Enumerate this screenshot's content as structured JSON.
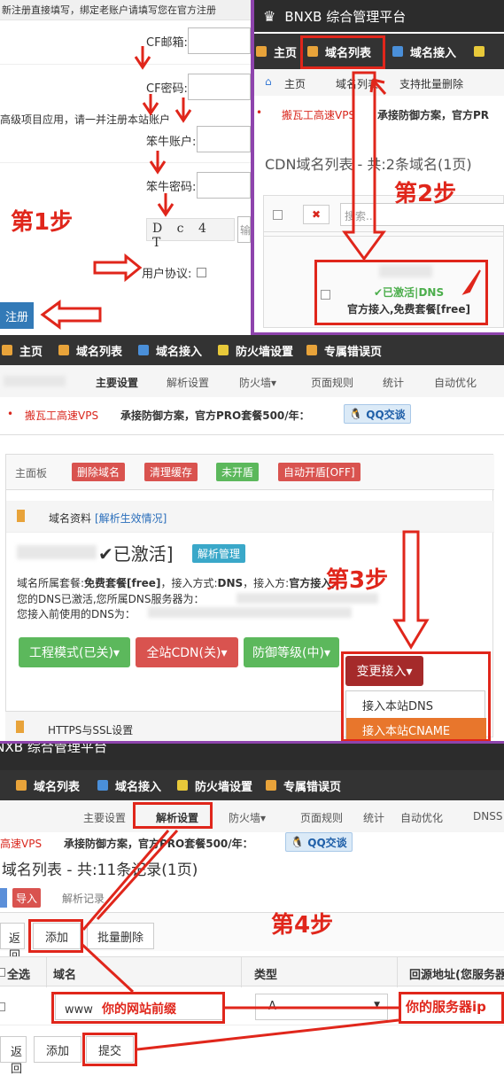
{
  "step1": {
    "notice": "新注册直接填写，绑定老账户请填写您在官方注册",
    "cf_email_label": "CF邮箱:",
    "cf_password_label": "CF密码:",
    "side_text": "高级项目应用，请一并注册本站账户",
    "nn_account_label": "笨牛账户:",
    "nn_password_label": "笨牛密码:",
    "captcha": "D c 4 T",
    "captcha_input_placeholder": "输",
    "agreement_label": "用户协议:",
    "register_button": "注册",
    "step_label": "第1步"
  },
  "step2": {
    "app_title": "BNXB 综合管理平台",
    "nav": [
      "主页",
      "域名列表",
      "域名接入"
    ],
    "breadcrumb_home": "主页",
    "breadcrumb_current": "域名列表",
    "breadcrumb_batch": "支持批量删除",
    "promo_link": "搬瓦工高速VPS",
    "promo_text": "承接防御方案，官方PR",
    "list_title": "CDN域名列表 - 共:2条域名(1页)",
    "search_placeholder": "搜索...",
    "status_line1": "✔已激活|DNS",
    "status_line2": "官方接入,免费套餐[free]",
    "step_label": "第2步"
  },
  "step3": {
    "nav": [
      "主页",
      "域名列表",
      "域名接入",
      "防火墙设置",
      "专属错误页"
    ],
    "subnav": [
      "主要设置",
      "解析设置",
      "防火墙▾",
      "页面规则",
      "统计",
      "自动优化"
    ],
    "promo_link": "搬瓦工高速VPS",
    "promo_text": "承接防御方案，官方PRO套餐500/年：",
    "qq_button": "QQ交谈",
    "panel_tabs": [
      "主面板",
      "删除域名",
      "清理缓存",
      "未开盾",
      "自动开盾[OFF]"
    ],
    "domain_info_title": "域名资料",
    "domain_info_link": "[解析生效情况]",
    "activated_text": "✔已激活]",
    "parse_manage": "解析管理",
    "info_line1_prefix": "域名所属套餐:",
    "info_line1_plan": "免费套餐[free]",
    "info_line1_mid": "，接入方式:",
    "info_line1_dns": "DNS",
    "info_line1_mid2": "，接入方:",
    "info_line1_official": "官方接入,",
    "info_line2": "您的DNS已激活,您所属DNS服务器为：",
    "info_line3": "您接入前使用的DNS为：",
    "buttons": [
      "工程模式(已关)▾",
      "全站CDN(关)▾",
      "防御等级(中)▾",
      "变更接入▾"
    ],
    "dropdown": [
      "接入本站DNS",
      "接入本站CNAME"
    ],
    "https_title": "HTTPS与SSL设置",
    "step_label": "第3步"
  },
  "step4": {
    "app_title_partial": "BNXB 综合管理平台",
    "nav": [
      "域名列表",
      "域名接入",
      "防火墙设置",
      "专属错误页"
    ],
    "subnav": [
      "主要设置",
      "解析设置",
      "防火墙▾",
      "页面规则",
      "统计",
      "自动优化",
      "DNSS"
    ],
    "promo_link": "高速VPS",
    "promo_text": "承接防御方案，官方PRO套餐500/年：",
    "qq_button": "QQ交谈",
    "list_title": "域名列表 - 共:11条记录(1页)",
    "import_button": "导入",
    "parse_record": "解析记录",
    "return_button": "返回",
    "add_button": "添加",
    "batch_delete_button": "批量删除",
    "columns": [
      "全选",
      "域名",
      "类型",
      "回源地址(您服务器"
    ],
    "row_domain_value": "www",
    "row_domain_hint": "你的网站前缀",
    "row_type_value": "A",
    "row_ip_hint": "你的服务器ip",
    "bottom_buttons": [
      "返回",
      "添加",
      "提交"
    ],
    "step_label": "第4步"
  },
  "colors": {
    "accent_red": "#e0261b",
    "dark_nav": "#2c2c2c",
    "purple_border": "#8e44ad",
    "green": "#4cae4c",
    "red_btn": "#d9534f",
    "dark_red": "#a52a2a",
    "link_blue": "#2a6ebb"
  }
}
